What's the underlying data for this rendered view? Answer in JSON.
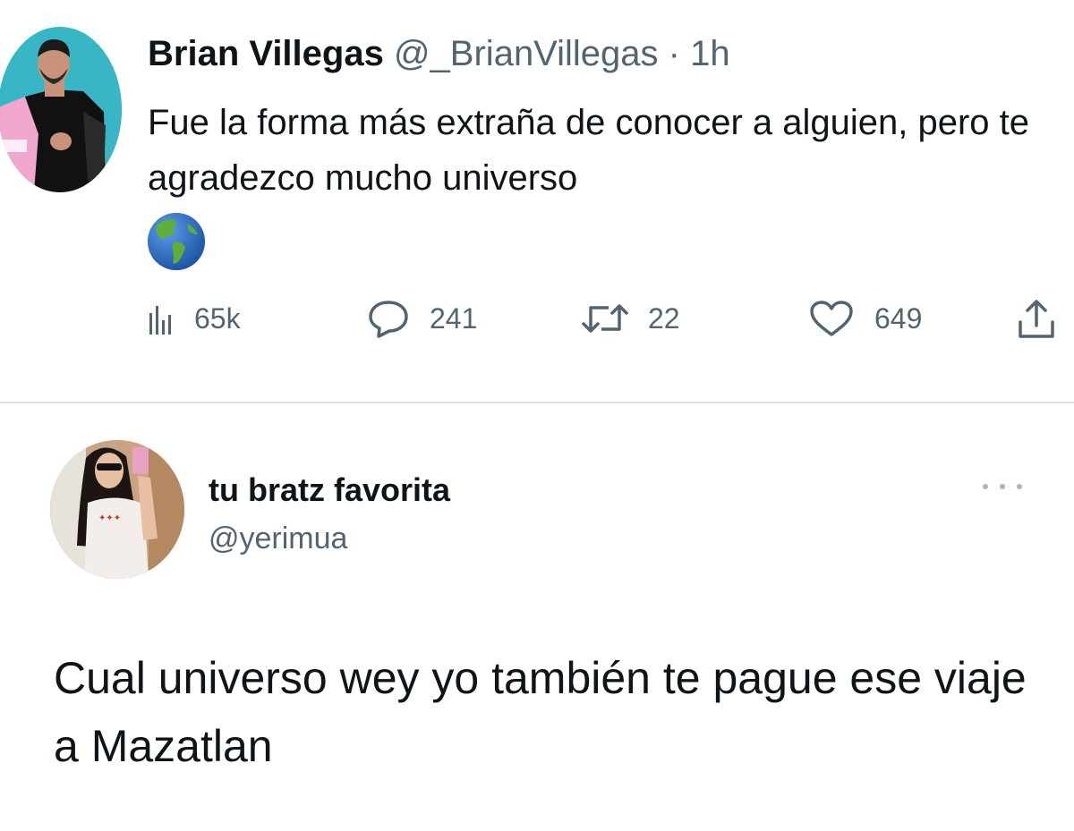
{
  "tweet_main": {
    "author_name": "Brian Villegas",
    "author_handle": "@_BrianVillegas",
    "separator": "·",
    "time": "1h",
    "text": "Fue la forma más extraña de conocer a alguien, pero te agradezco mucho universo",
    "emoji": "globe-americas",
    "stats": {
      "views": "65k",
      "replies": "241",
      "retweets": "22",
      "likes": "649"
    },
    "icons": {
      "views": "views-chart-icon",
      "replies": "reply-icon",
      "retweets": "retweet-icon",
      "likes": "heart-icon",
      "share": "share-icon"
    }
  },
  "tweet_reply": {
    "author_name": "tu bratz favorita",
    "author_handle": "@yerimua",
    "text": "Cual universo wey yo también te pague ese viaje a Mazatlan",
    "more_icon": "more-options-icon"
  },
  "colors": {
    "text": "#0f1419",
    "muted": "#536471",
    "divider": "#dfe3e6",
    "avatar1_bg": "#3ab7c7"
  }
}
